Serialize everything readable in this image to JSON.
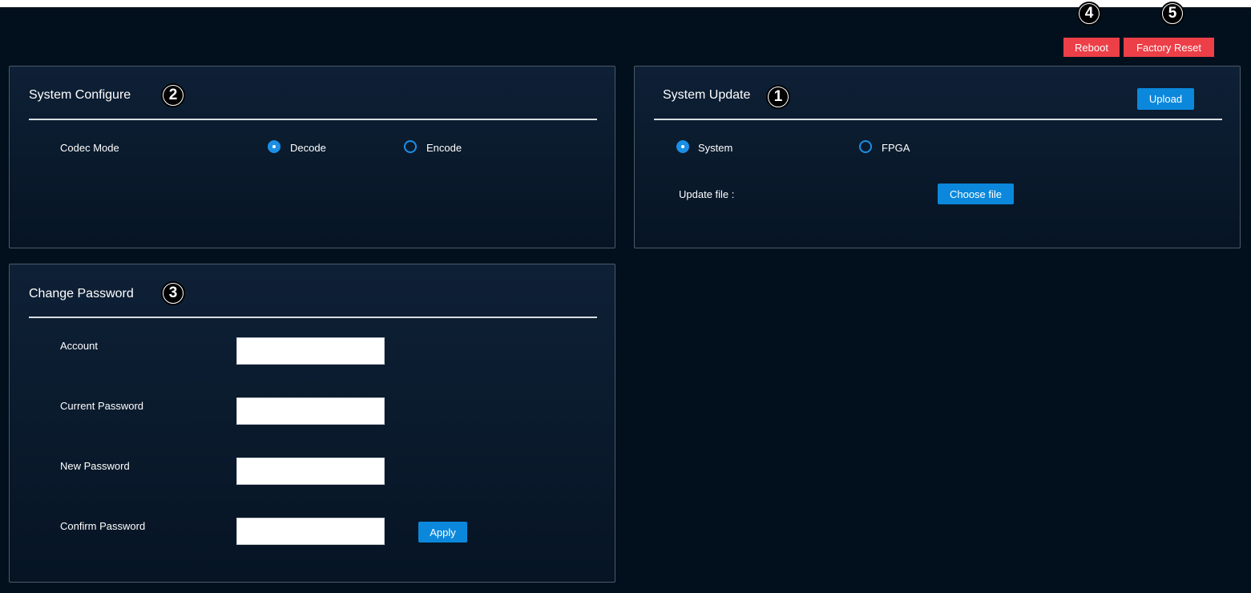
{
  "header": {
    "reboot_label": "Reboot",
    "factory_reset_label": "Factory Reset",
    "callout_reboot": "4",
    "callout_factory_reset": "5"
  },
  "system_configure": {
    "title": "System Configure",
    "callout": "2",
    "codec_mode_label": "Codec Mode",
    "options": [
      "Decode",
      "Encode"
    ],
    "selected": "Decode"
  },
  "system_update": {
    "title": "System Update",
    "callout": "1",
    "upload_label": "Upload",
    "options": [
      "System",
      "FPGA"
    ],
    "selected": "System",
    "update_file_label": "Update file :",
    "choose_file_label": "Choose file"
  },
  "change_password": {
    "title": "Change Password",
    "callout": "3",
    "fields": [
      {
        "label": "Account",
        "value": ""
      },
      {
        "label": "Current Password",
        "value": ""
      },
      {
        "label": "New Password",
        "value": ""
      },
      {
        "label": "Confirm Password",
        "value": ""
      }
    ],
    "apply_label": "Apply"
  },
  "colors": {
    "background": "#02101d",
    "danger": "#ec3f48",
    "accent": "#0b88dc"
  }
}
